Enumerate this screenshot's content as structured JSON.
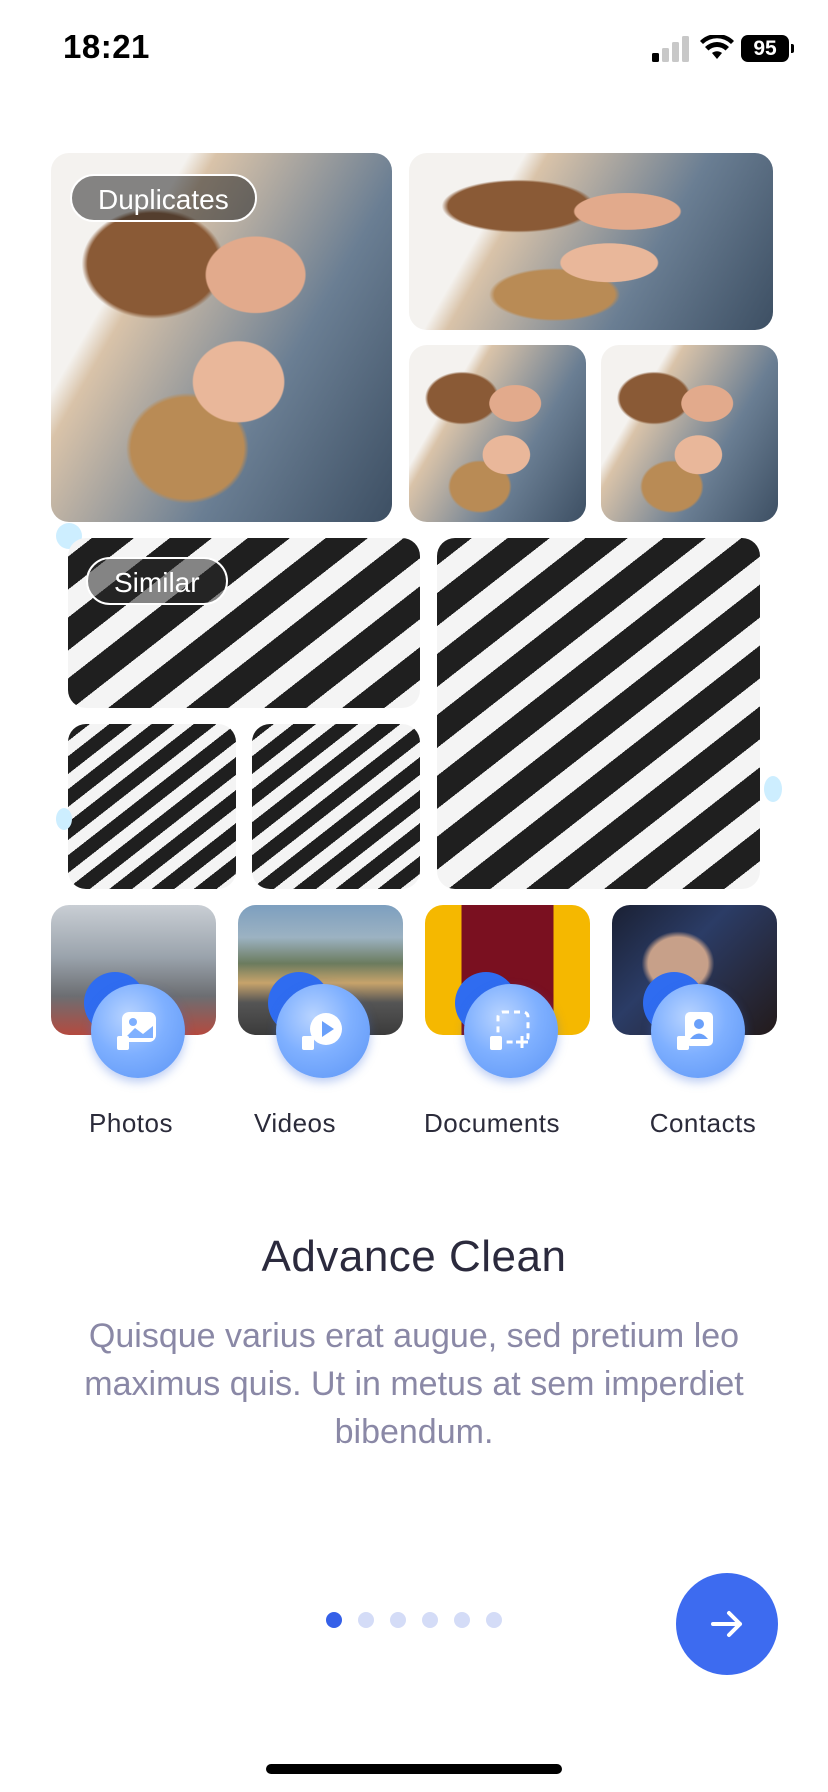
{
  "status_bar": {
    "time": "18:21",
    "battery": "95"
  },
  "collage": {
    "duplicates_label": "Duplicates",
    "similar_label": "Similar"
  },
  "categories": [
    {
      "label": "Photos",
      "icon": "photos-icon"
    },
    {
      "label": "Videos",
      "icon": "videos-icon"
    },
    {
      "label": "Documents",
      "icon": "documents-icon"
    },
    {
      "label": "Contacts",
      "icon": "contacts-icon"
    }
  ],
  "content": {
    "title": "Advance Clean",
    "description": "Quisque varius erat augue, sed pretium leo maximus quis. Ut in metus at sem imperdiet bibendum."
  },
  "pagination": {
    "total": 6,
    "active": 1
  },
  "colors": {
    "accent": "#3d6bf0",
    "dot_inactive": "#d4dcf7",
    "description": "#8a88a6",
    "title": "#2b2a3d"
  },
  "next_button": {
    "icon": "arrow-right-icon"
  }
}
